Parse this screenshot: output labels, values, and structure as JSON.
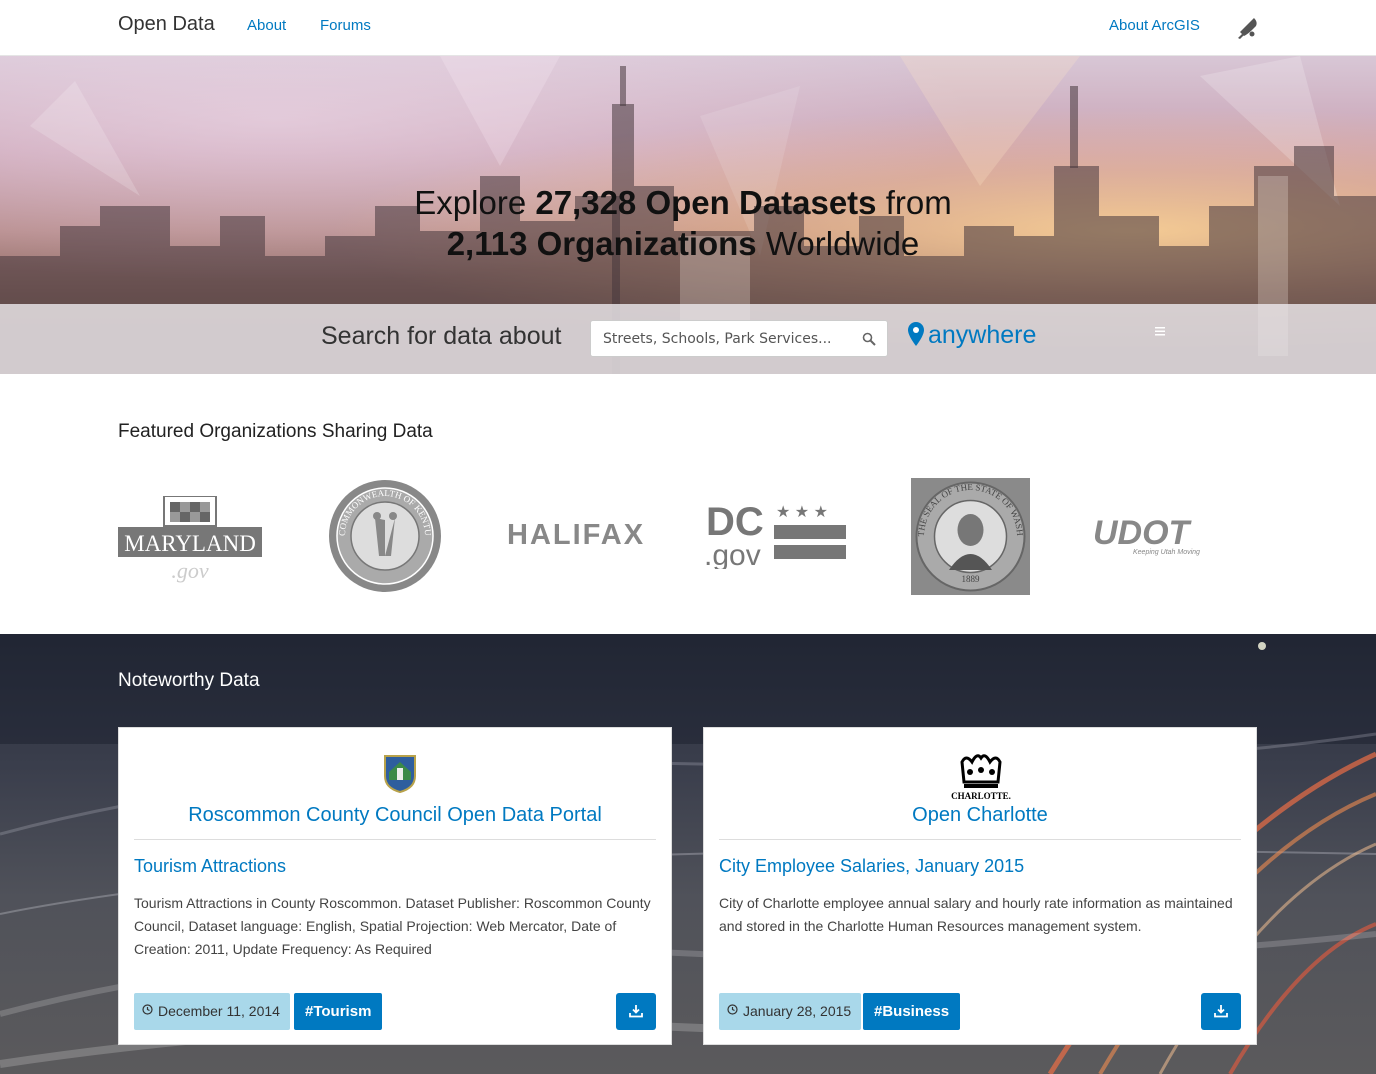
{
  "nav": {
    "brand": "Open Data",
    "links": [
      "About",
      "Forums"
    ],
    "right_link": "About ArcGIS",
    "bell_icon": "bell-icon"
  },
  "hero": {
    "line1_pre": "Explore ",
    "line1_bold": "27,328 Open Datasets",
    "line1_post": " from",
    "line2_bold": "2,113 Organizations",
    "line2_post": " Worldwide",
    "search_label": "Search for data about",
    "search_placeholder": "Streets, Schools, Park Services...",
    "location_label": "anywhere"
  },
  "featured": {
    "title": "Featured Organizations Sharing Data",
    "logos": [
      {
        "name": "maryland-logo",
        "text": "MARYLAND",
        "subtext": ".gov"
      },
      {
        "name": "kentucky-seal",
        "text": "COMMONWEALTH OF KENTUCKY",
        "subtext": "UNITED WE STAND · DIVIDED WE FALL"
      },
      {
        "name": "halifax-logo",
        "text": "HALIFAX"
      },
      {
        "name": "dc-gov-logo",
        "text": "DC",
        "subtext": ".gov"
      },
      {
        "name": "washington-seal",
        "text": "THE SEAL OF THE STATE OF WASHINGTON",
        "subtext": "1889"
      },
      {
        "name": "udot-logo",
        "text": "UDOT",
        "subtext": "Keeping Utah Moving"
      }
    ]
  },
  "noteworthy": {
    "title": "Noteworthy Data",
    "cards": [
      {
        "org": "Roscommon County Council Open Data Portal",
        "title": "Tourism Attractions",
        "description": "Tourism Attractions in County Roscommon. Dataset Publisher: Roscommon County Council, Dataset language: English, Spatial Projection: Web Mercator, Date of Creation: 2011, Update Frequency: As Required",
        "date": "December 11, 2014",
        "tag": "#Tourism"
      },
      {
        "org": "Open Charlotte",
        "org_logo_text": "CHARLOTTE.",
        "title": "City Employee Salaries, January 2015",
        "description": "City of Charlotte employee annual salary and hourly rate information as maintained and stored in the Charlotte Human Resources management system.",
        "date": "January 28, 2015",
        "tag": "#Business"
      }
    ]
  },
  "colors": {
    "accent": "#0079c1",
    "date_badge": "#a9d8ea"
  }
}
